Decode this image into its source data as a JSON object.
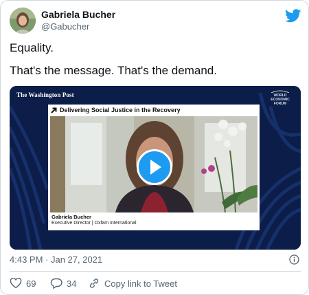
{
  "author": {
    "name": "Gabriela Bucher",
    "handle": "@Gabucher"
  },
  "tweet": {
    "line1": "Equality.",
    "line2": "That's the message. That's the demand."
  },
  "media": {
    "publisher_logo": "The Washington Post",
    "wef_logo": "WORLD ECONOMIC FORUM",
    "segment_title": "Delivering Social Justice in the Recovery",
    "speaker_name": "Gabriela Bucher",
    "speaker_role": "Executive Director | Oxfam International",
    "play_icon": "play-icon"
  },
  "meta": {
    "timestamp": "4:43 PM · Jan 27, 2021"
  },
  "actions": {
    "likes": "69",
    "replies": "34",
    "copy_link": "Copy link to Tweet"
  },
  "colors": {
    "twitter_blue": "#1d9bf0",
    "text": "#0f1419",
    "muted": "#536471",
    "video_bg": "#0b1d48"
  }
}
